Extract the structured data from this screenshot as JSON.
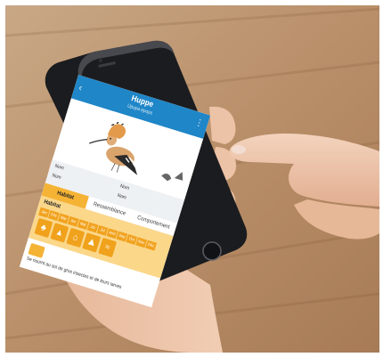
{
  "app": {
    "title": "Huppe",
    "subtitle": "Upupa epops"
  },
  "info": {
    "left_top": "Nom",
    "left_bottom": "Nom",
    "right_top": "Nom",
    "right_bottom": "Nom"
  },
  "tabs": [
    {
      "label": "Habitat",
      "active": true
    },
    {
      "label": "Ressemblance",
      "active": false
    },
    {
      "label": "Comportement",
      "active": false
    }
  ],
  "habitat": {
    "title": "Habitat",
    "months": [
      "Jan",
      "Fév",
      "Mar",
      "Avr",
      "Mai",
      "Jui",
      "Jul",
      "Aoû",
      "Sep",
      "Oct",
      "Nov",
      "Déc"
    ]
  },
  "notes": {
    "text": "Se nourrit au sol de gros insectes et de leurs larves"
  },
  "icons": {
    "back": "back-arrow-icon",
    "more": "more-vertical-icon"
  },
  "colors": {
    "app_bar": "#1f86c8",
    "accent": "#f5b335",
    "habitat_bg": "#fbd78a",
    "phone_body": "#1b1c1f"
  }
}
